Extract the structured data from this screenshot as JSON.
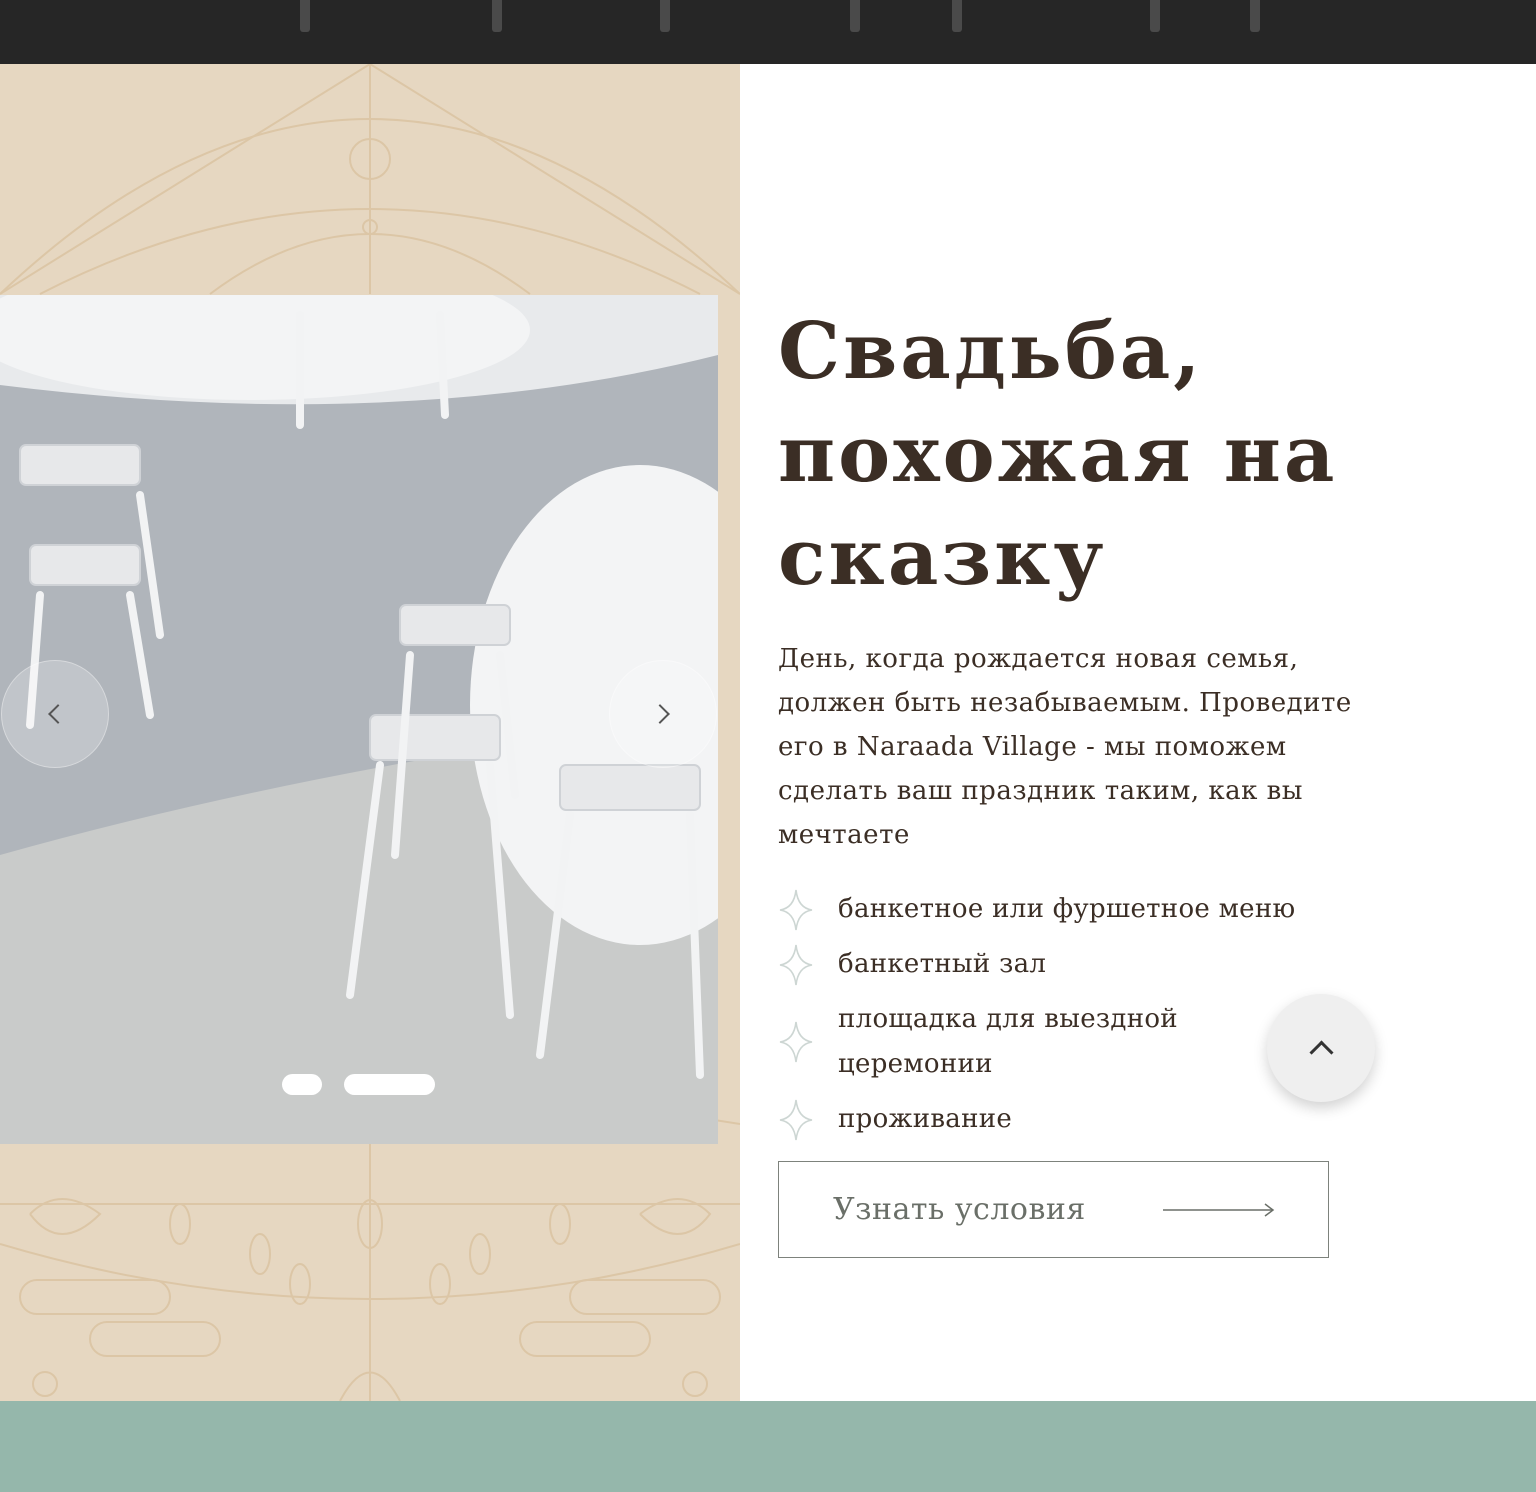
{
  "hero": {
    "title_lines": [
      "Свадьба,",
      "похожая на",
      "сказку"
    ],
    "lead": "День, когда рождается новая семья, должен быть незабываемым. Проведите его в Naraada Village - мы поможем сделать ваш праздник таким, как вы мечтаете"
  },
  "features": [
    {
      "text": "банкетное или фуршетное меню",
      "icon": "sparkle-icon"
    },
    {
      "text": "банкетный зал",
      "icon": "sparkle-icon"
    },
    {
      "text": "площадка для выездной церемонии",
      "icon": "sparkle-icon"
    },
    {
      "text": "проживание",
      "icon": "sparkle-icon"
    }
  ],
  "cta": {
    "label": "Узнать условия",
    "icon": "arrow-right-icon"
  },
  "slider": {
    "slide_count": 2,
    "active_slide": 2,
    "prev_icon": "chevron-left-icon",
    "next_icon": "chevron-right-icon"
  },
  "scroll_top": {
    "icon": "chevron-up-icon"
  },
  "colors": {
    "panel_beige": "#e6d7c1",
    "pattern_line": "#dcc6a6",
    "title_brown": "#3b2e25",
    "cta_border": "#7d827c",
    "bottom_band": "#95b7ab",
    "top_strip": "#262626"
  }
}
